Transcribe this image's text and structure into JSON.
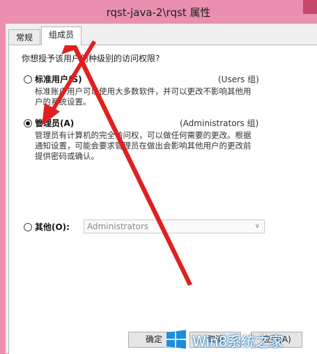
{
  "window": {
    "title": "rqst-java-2\\rqst 属性"
  },
  "tabs": [
    {
      "label": "常规"
    },
    {
      "label": "组成员"
    }
  ],
  "question": "你想授予该用户何种级别的访问权限?",
  "options": {
    "standard": {
      "label": "标准用户(S)",
      "group": "(Users 组)",
      "desc1": "标准账户用户可以使用大多数软件，并可以更改不影响其他用",
      "desc2": "户的系统设置。"
    },
    "admin": {
      "label": "管理员(A)",
      "group": "(Administrators 组)",
      "desc1": "管理员有计算机的完全访问权，可以做任何需要的更改。根据",
      "desc2": "通知设置，可能会要求管理员在做出会影响其他用户的更改前",
      "desc3": "提供密码或确认。"
    },
    "other": {
      "label": "其他(O):",
      "selected": "Administrators"
    }
  },
  "buttons": {
    "ok": "确定",
    "cancel": "取消",
    "apply": "应用(A)"
  },
  "watermark": "Win8系统之家",
  "colors": {
    "titlebar": "#ea8fb0",
    "arrow": "#e02020",
    "watermark_blue": "#1a6fb5"
  }
}
